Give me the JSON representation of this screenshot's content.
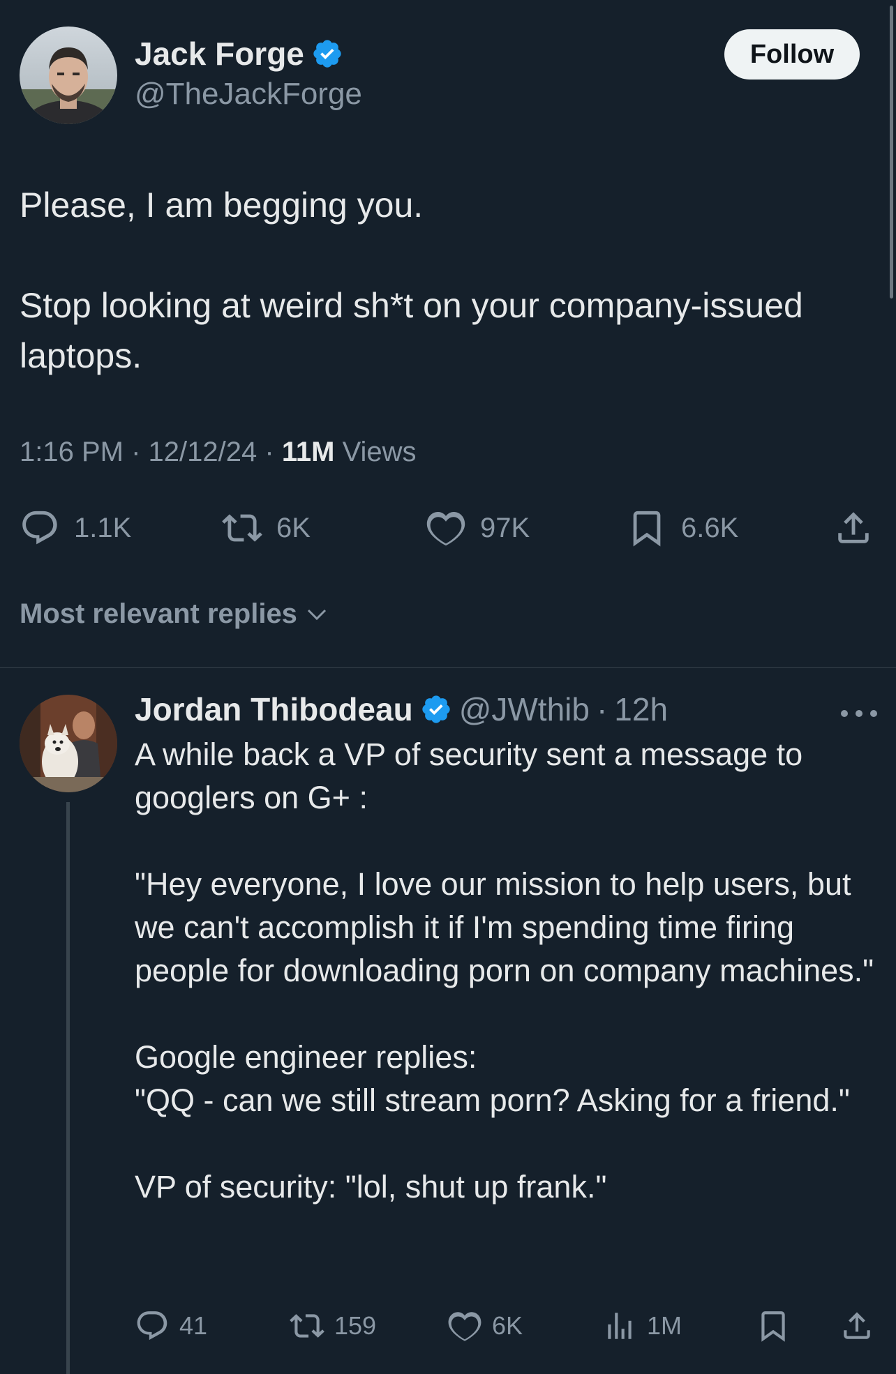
{
  "tweet": {
    "author": {
      "name": "Jack Forge",
      "handle": "@TheJackForge",
      "verified": true
    },
    "follow_label": "Follow",
    "text": {
      "line1": "Please, I am begging you.",
      "line2": "Stop looking at weird sh*t on your company-issued laptops."
    },
    "time": "1:16 PM",
    "sep": "·",
    "date": "12/12/24",
    "views_count": "11M",
    "views_label": "Views",
    "actions": {
      "replies": "1.1K",
      "reposts": "6K",
      "likes": "97K",
      "bookmarks": "6.6K"
    }
  },
  "sort": {
    "label": "Most relevant replies"
  },
  "reply": {
    "author": {
      "name": "Jordan Thibodeau",
      "handle": "@JWthib",
      "verified": true
    },
    "sep": "·",
    "time": "12h",
    "paragraphs": [
      "A while back a VP of security sent a message to googlers on G+ :",
      "\"Hey everyone, I love our mission to help users, but we can't accomplish it if I'm spending time firing people for downloading porn on company machines.\"",
      "Google engineer replies:",
      "\"QQ - can we still stream porn? Asking for a friend.\"",
      "VP of security: \"lol, shut up frank.\""
    ],
    "actions": {
      "replies": "41",
      "reposts": "159",
      "likes": "6K",
      "views": "1M"
    }
  },
  "colors": {
    "background": "#15202b",
    "text_primary": "#e7e9ea",
    "text_secondary": "#8b98a5",
    "verified_blue": "#1d9bf0",
    "divider": "#38444d"
  },
  "icons": {
    "verified": "verified-badge-icon",
    "reply": "reply-bubble-icon",
    "repost": "repost-icon",
    "like": "heart-icon",
    "bookmark": "bookmark-icon",
    "share": "share-icon",
    "views": "analytics-bars-icon",
    "more": "more-dots-icon",
    "sort_chevron": "chevron-down-icon"
  }
}
